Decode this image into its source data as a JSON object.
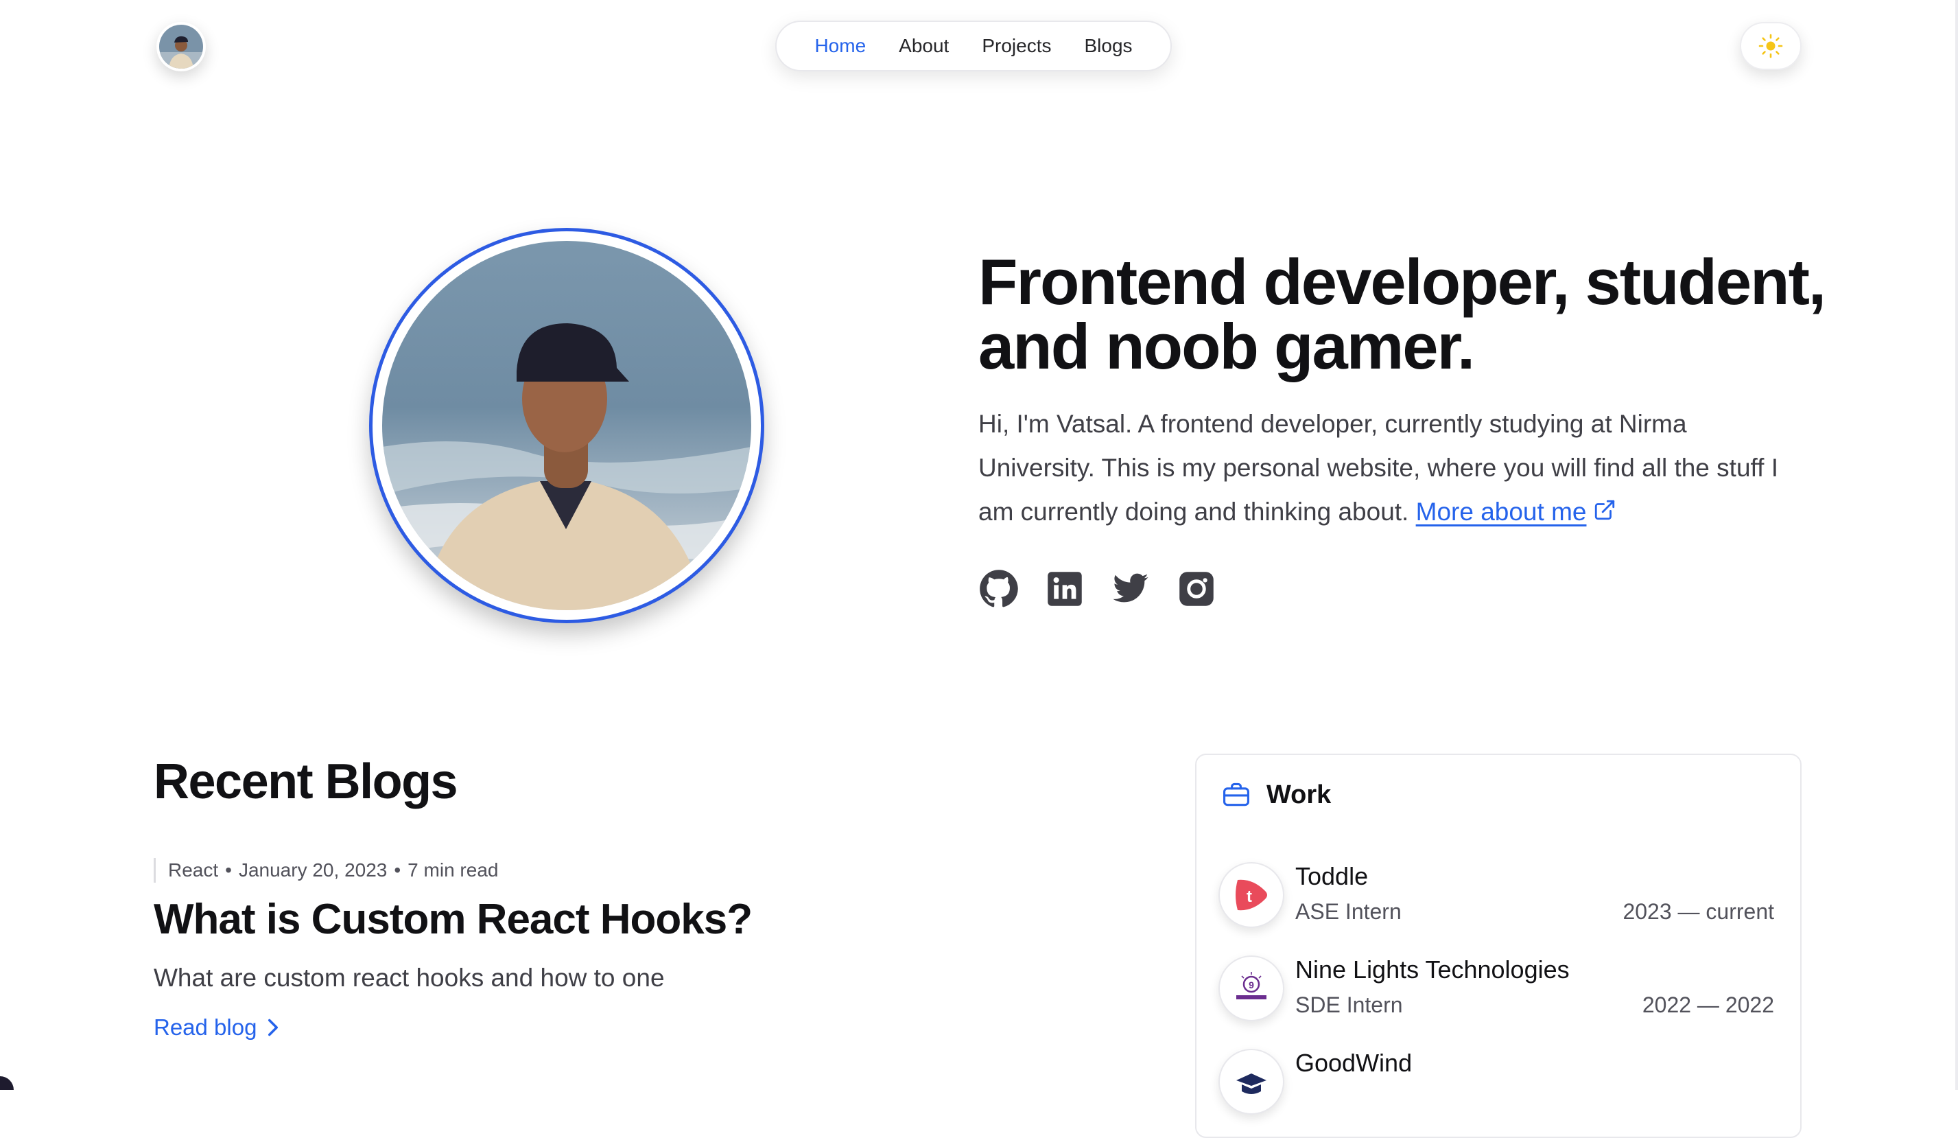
{
  "header": {
    "nav": [
      {
        "label": "Home",
        "active": true
      },
      {
        "label": "About",
        "active": false
      },
      {
        "label": "Projects",
        "active": false
      },
      {
        "label": "Blogs",
        "active": false
      }
    ],
    "theme_icon": "sun-icon"
  },
  "hero": {
    "title": "Frontend developer, student, and noob gamer.",
    "intro": "Hi, I'm Vatsal. A frontend developer, currently studying at Nirma University. This is my personal website, where you will find all the stuff I am currently doing and thinking about.",
    "more_link": "More about me",
    "socials": [
      "github-icon",
      "linkedin-icon",
      "twitter-icon",
      "instagram-icon"
    ]
  },
  "blogs": {
    "section_title": "Recent Blogs",
    "items": [
      {
        "category": "React",
        "date": "January 20, 2023",
        "read_time": "7 min read",
        "title": "What is Custom React Hooks?",
        "description": "What are custom react hooks and how to one",
        "cta": "Read blog"
      }
    ]
  },
  "work": {
    "title": "Work",
    "items": [
      {
        "company": "Toddle",
        "role": "ASE Intern",
        "dates": "2023 — current",
        "logo": "toddle-logo"
      },
      {
        "company": "Nine Lights Technologies",
        "role": "SDE Intern",
        "dates": "2022 — 2022",
        "logo": "nine-lights-logo"
      },
      {
        "company": "GoodWind",
        "role": "",
        "dates": "",
        "logo": "goodwind-logo"
      }
    ]
  },
  "colors": {
    "accent": "#2563eb",
    "photo_ring": "#2d5be3",
    "sun": "#f5c518",
    "toddle": "#e94b5b"
  }
}
